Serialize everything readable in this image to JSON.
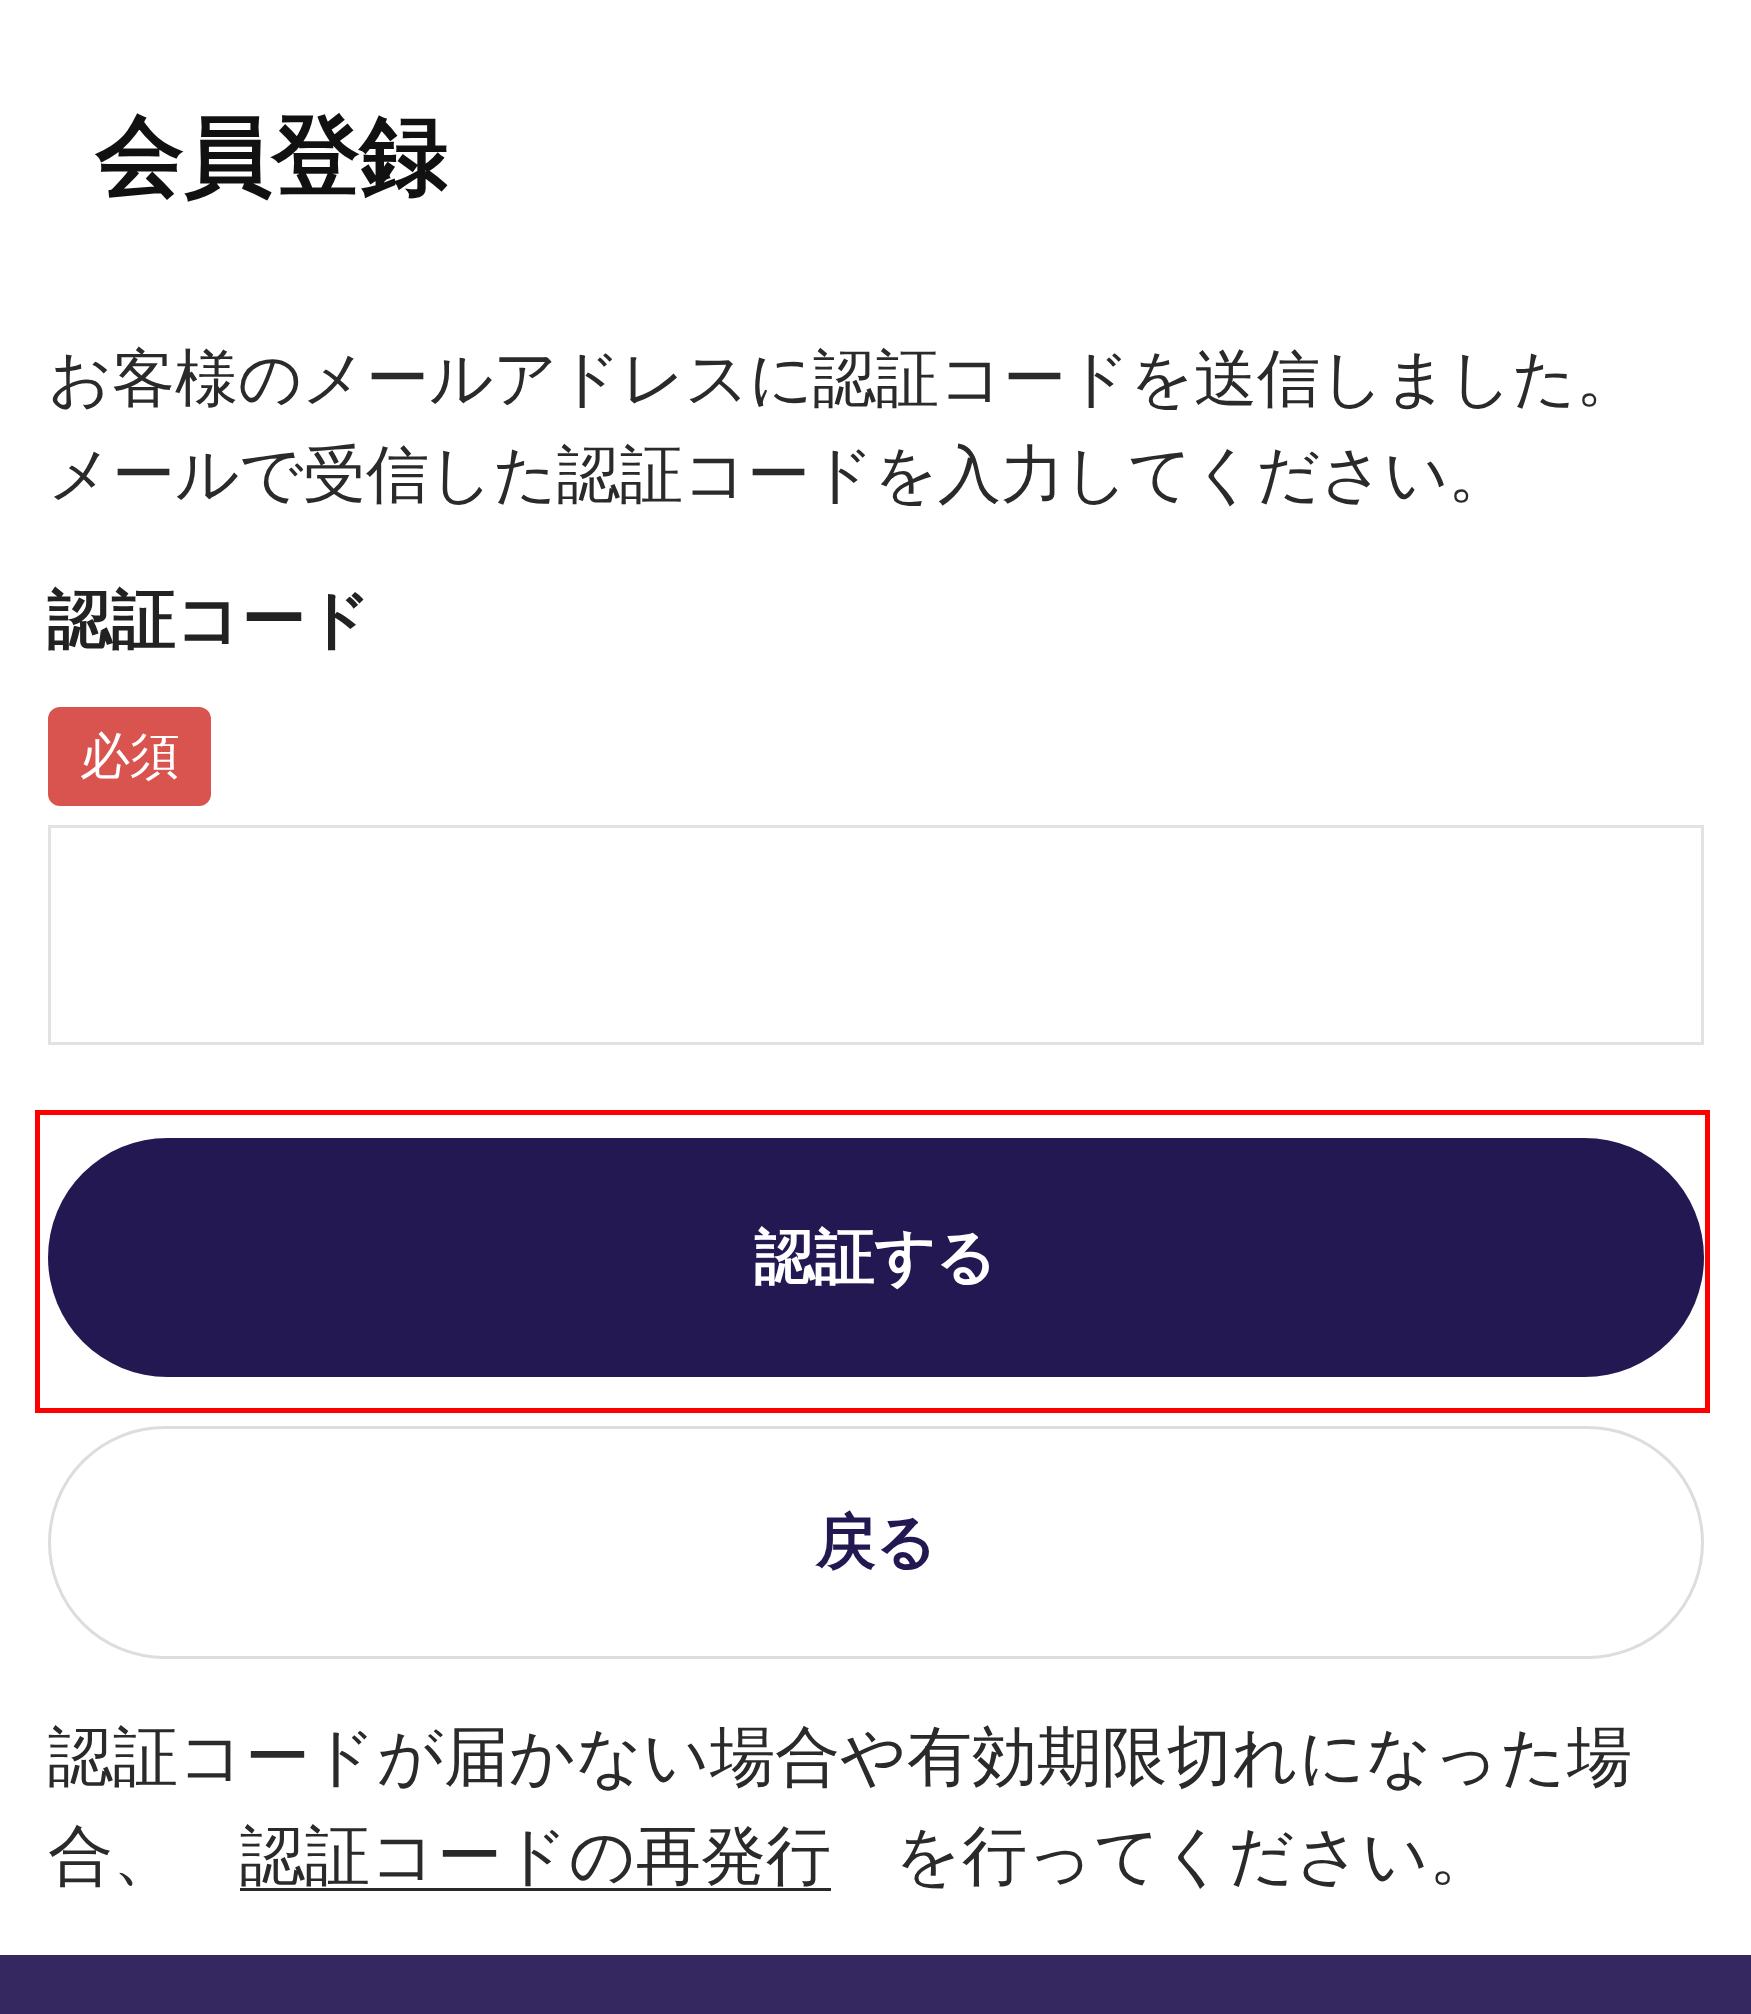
{
  "page": {
    "title": "会員登録"
  },
  "message": "お客様のメールアドレスに認証コードを送信しました。メールで受信した認証コードを入力してください。",
  "field": {
    "label": "認証コード",
    "required_badge": "必須"
  },
  "buttons": [
    {
      "label": "認証する",
      "kind": "primary",
      "highlighted": true
    },
    {
      "label": "戻る",
      "kind": "secondary",
      "highlighted": false
    }
  ],
  "note": {
    "before": "認証コードが届かない場合や有効期限切れになった場合、",
    "link": "認証コードの再発行",
    "after": "を行ってください。"
  }
}
